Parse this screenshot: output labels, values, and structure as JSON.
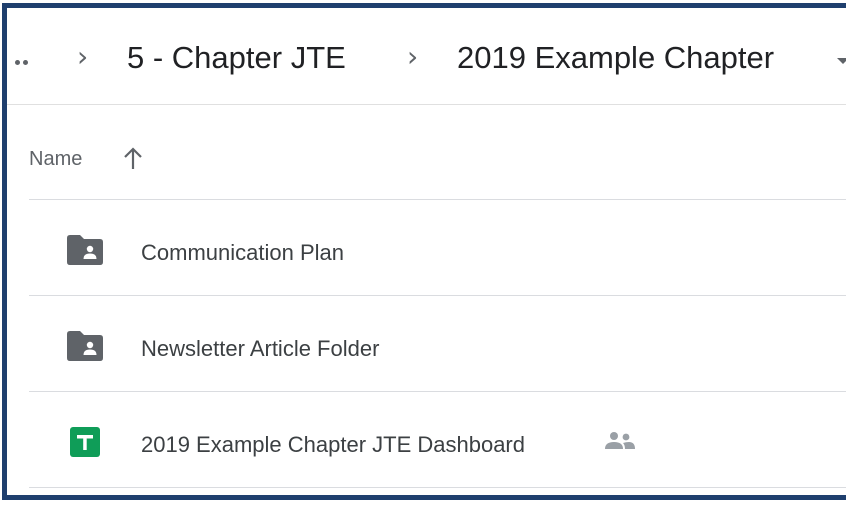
{
  "breadcrumb": {
    "more_label": "More",
    "items": [
      {
        "label": "5 - Chapter JTE"
      },
      {
        "label": "2019 Example Chapter"
      }
    ]
  },
  "list_header": {
    "name_label": "Name",
    "sort_icon": "arrow-up-icon"
  },
  "rows": [
    {
      "name": "Communication Plan",
      "icon": "shared-folder-icon"
    },
    {
      "name": "Newsletter Article Folder",
      "icon": "shared-folder-icon"
    },
    {
      "name": "2019 Example Chapter JTE Dashboard",
      "icon": "google-sheets-icon",
      "shared": true
    }
  ],
  "colors": {
    "frame": "#1f3f6e",
    "sheets_green": "#0f9d58",
    "folder_gray": "#5f6368"
  }
}
